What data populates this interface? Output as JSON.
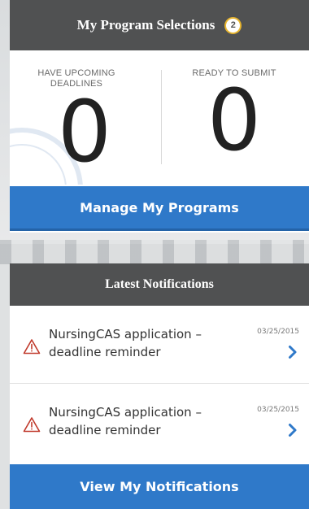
{
  "selections": {
    "title": "My Program Selections",
    "count": "2",
    "stats": [
      {
        "label": "HAVE UPCOMING DEADLINES",
        "value": "0"
      },
      {
        "label": "READY TO SUBMIT",
        "value": "0"
      }
    ],
    "manage_label": "Manage My Programs"
  },
  "notifications": {
    "title": "Latest Notifications",
    "items": [
      {
        "text": "NursingCAS application – deadline reminder",
        "date": "03/25/2015"
      },
      {
        "text": "NursingCAS application – deadline reminder",
        "date": "03/25/2015"
      }
    ],
    "view_label": "View My Notifications"
  },
  "colors": {
    "header_bg": "#505152",
    "button_blue": "#2f79c9",
    "badge_ring": "#e8b52e",
    "warning_red": "#c0392b",
    "chevron_blue": "#2f79c9"
  },
  "icons": {
    "warning": "warning-triangle-icon",
    "chevron": "chevron-right-icon"
  }
}
